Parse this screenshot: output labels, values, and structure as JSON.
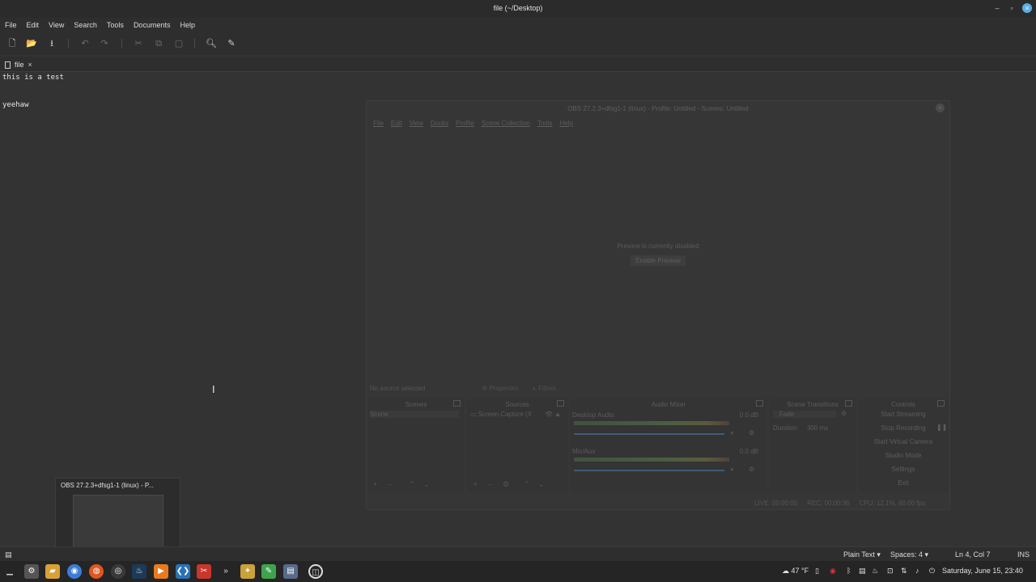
{
  "window": {
    "title": "file (~/Desktop)"
  },
  "menu": [
    "File",
    "Edit",
    "View",
    "Search",
    "Tools",
    "Documents",
    "Help"
  ],
  "tab": {
    "label": "file"
  },
  "editor": {
    "lines": [
      "this is a test",
      "",
      "yeehaw"
    ]
  },
  "obs": {
    "title": "OBS 27.2.3+dfsg1-1 (linux) - Profile: Untitled - Scenes: Untitled",
    "menu": [
      "File",
      "Edit",
      "View",
      "Docks",
      "Profile",
      "Scene Collection",
      "Tools",
      "Help"
    ],
    "preview_disabled": "Preview is currently disabled",
    "enable_preview": "Enable Preview",
    "no_source": "No source selected",
    "properties": "Properties",
    "filters": "Filters",
    "docks": {
      "scenes": {
        "title": "Scenes",
        "items": [
          "Scene"
        ]
      },
      "sources": {
        "title": "Sources",
        "items": [
          "Screen Capture (X"
        ]
      },
      "audio_mixer": {
        "title": "Audio Mixer",
        "channels": [
          {
            "name": "Desktop Audio",
            "db": "0.0 dB"
          },
          {
            "name": "Mic/Aux",
            "db": "0.0 dB"
          }
        ]
      },
      "transitions": {
        "title": "Scene Transitions",
        "selected": "Fade",
        "duration_label": "Duration",
        "duration_value": "300 ms"
      },
      "controls": {
        "title": "Controls",
        "buttons": [
          "Start Streaming",
          "Stop Recording",
          "Start Virtual Camera",
          "Studio Mode",
          "Settings",
          "Exit"
        ]
      }
    },
    "status": {
      "live": "LIVE: 00:00:00",
      "rec": "REC: 00:00:36",
      "cpu": "CPU: 12.1%, 60.00 fps"
    }
  },
  "thumbnail": {
    "title": "OBS 27.2.3+dfsg1-1 (linux) - P..."
  },
  "statusbar": {
    "language": "Plain Text",
    "spaces": "Spaces: 4",
    "position": "Ln 4, Col 7",
    "mode": "INS"
  },
  "panel": {
    "temperature": "47 °F",
    "clock": "Saturday, June 15, 23:40"
  }
}
